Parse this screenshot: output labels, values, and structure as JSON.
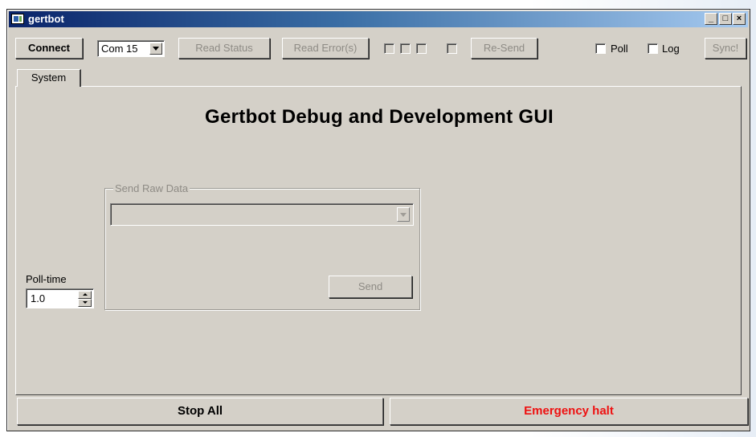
{
  "window": {
    "title": "gertbot",
    "controls": {
      "minimize": "_",
      "maximize": "□",
      "close": "×"
    }
  },
  "toolbar": {
    "connect_label": "Connect",
    "com_port": {
      "selected": "Com 15"
    },
    "read_status_label": "Read Status",
    "read_errors_label": "Read Error(s)",
    "resend_label": "Re-Send",
    "poll_label": "Poll",
    "log_label": "Log",
    "sync_label": "Sync!"
  },
  "tabs": [
    {
      "label": "System",
      "active": true
    }
  ],
  "main": {
    "title": "Gertbot Debug and Development GUI",
    "raw_data": {
      "legend": "Send Raw Data",
      "combo_value": "",
      "send_label": "Send"
    },
    "poll_time": {
      "label": "Poll-time",
      "value": "1.0"
    }
  },
  "footer": {
    "stop_all_label": "Stop All",
    "emergency_label": "Emergency halt",
    "emergency_color": "#ee1111"
  }
}
